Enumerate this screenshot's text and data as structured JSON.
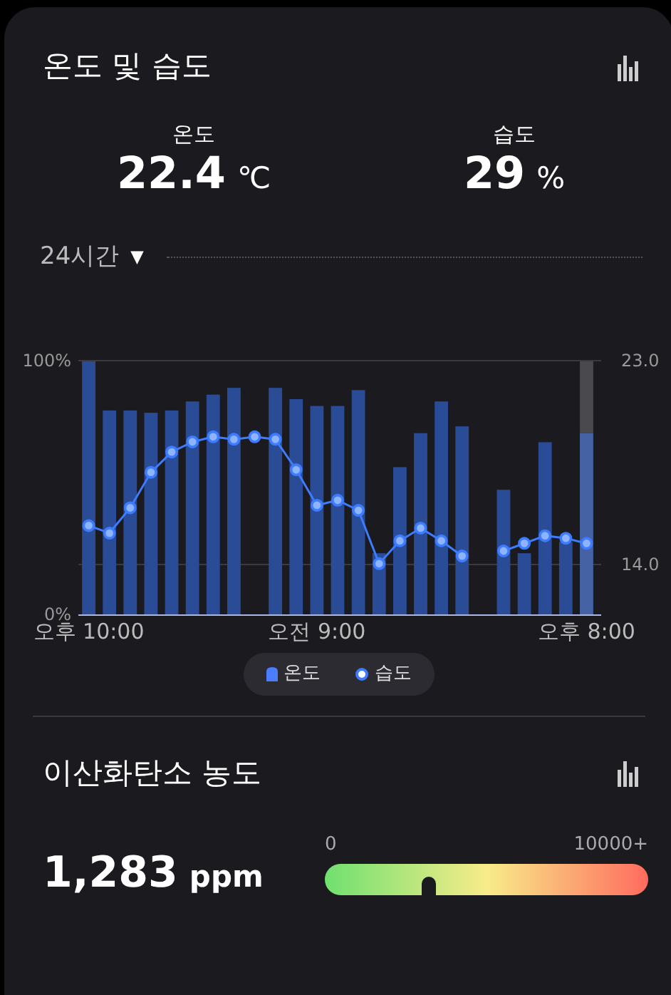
{
  "climate": {
    "title": "온도 및 습도",
    "readings": [
      {
        "label": "온도",
        "value": "22.4",
        "unit": "℃"
      },
      {
        "label": "습도",
        "value": "29",
        "unit": "%"
      }
    ],
    "range": {
      "label": "24시간",
      "caret": "▼"
    },
    "temperature_chart": {
      "chart_data": {
        "type": "bar",
        "categories": [
          "오후 10:00",
          null,
          null,
          null,
          null,
          null,
          null,
          null,
          null,
          null,
          null,
          "오전 9:00",
          null,
          null,
          null,
          null,
          null,
          null,
          null,
          null,
          null,
          null,
          null,
          null,
          "오후 8:00"
        ],
        "ylim": [
          11.8,
          23
        ],
        "yticks": [
          {
            "value": 14,
            "label": "14.0"
          },
          {
            "value": 23,
            "label": "23.0"
          }
        ],
        "series": [
          {
            "name": "온도",
            "color": "#2a4c97",
            "values": [
              23.0,
              20.8,
              20.8,
              20.7,
              20.8,
              21.2,
              21.5,
              21.8,
              null,
              21.8,
              21.3,
              21.0,
              21.0,
              21.7,
              14.5,
              18.3,
              19.8,
              21.2,
              20.1,
              null,
              17.3,
              14.5,
              19.4,
              15.0,
              19.8
            ]
          }
        ]
      }
    },
    "humidity_chart": {
      "chart_data": {
        "type": "line",
        "categories": [
          null,
          null,
          null,
          null,
          null,
          null,
          null,
          null,
          null,
          null,
          null,
          null,
          null,
          null,
          null,
          null,
          null,
          null,
          null,
          null,
          null,
          null,
          null,
          null,
          null
        ],
        "ylim": [
          0,
          100
        ],
        "yticks": [
          {
            "value": 0,
            "label": "0%"
          },
          {
            "value": 100,
            "label": "100%"
          }
        ],
        "series": [
          {
            "name": "습도",
            "color": "#3d7bff",
            "marker": "o",
            "values": [
              35,
              32,
              42,
              56,
              64,
              68,
              70,
              69,
              70,
              69,
              57,
              43,
              45,
              41,
              20,
              29,
              34,
              29,
              23,
              null,
              25,
              28,
              31,
              30,
              28
            ]
          }
        ]
      }
    }
  },
  "co2": {
    "title": "이산화탄소 농도",
    "value": "1,283",
    "unit": "ppm",
    "scale_min": "0",
    "scale_max": "10000+",
    "level": 0.32
  }
}
